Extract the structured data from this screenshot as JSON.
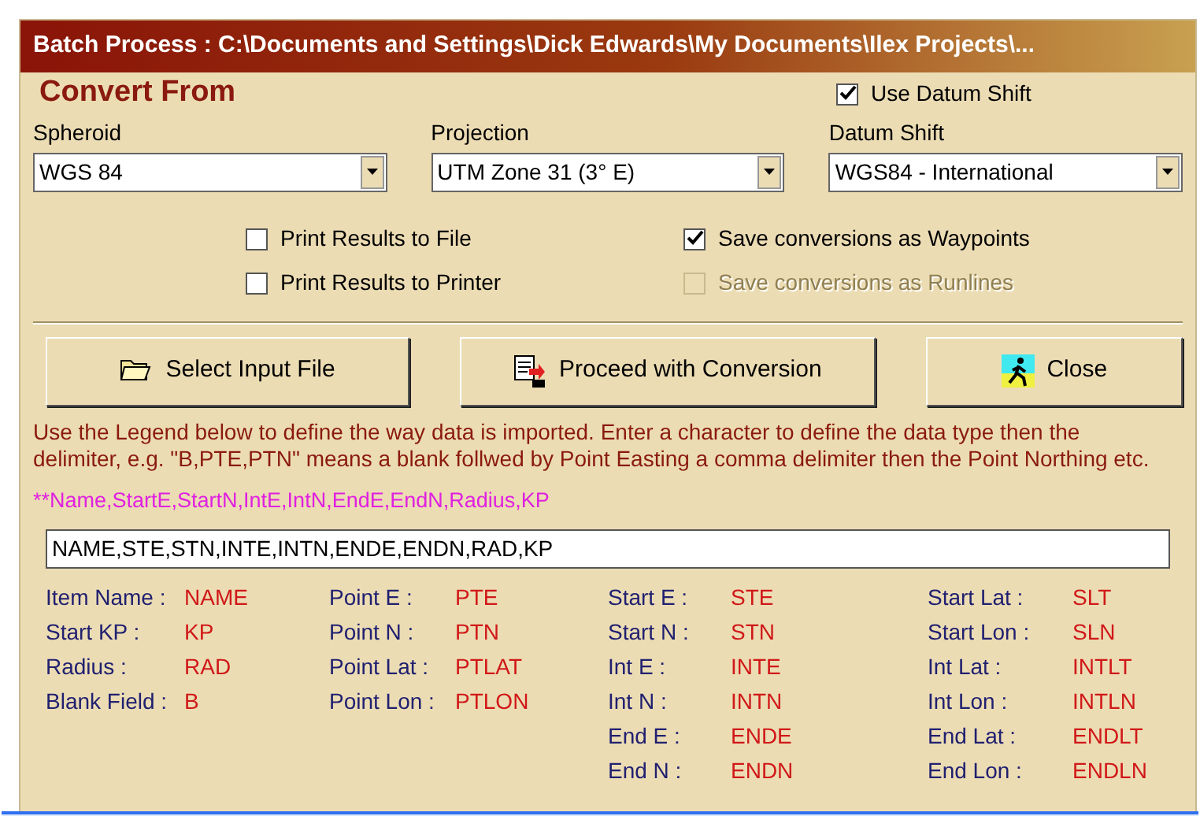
{
  "window": {
    "title": "Batch Process : C:\\Documents and Settings\\Dick Edwards\\My Documents\\Ilex Projects\\..."
  },
  "heading": "Convert From",
  "use_datum_shift": {
    "label": "Use Datum Shift",
    "checked": true
  },
  "dropdowns": [
    {
      "label": "Spheroid",
      "value": "WGS 84"
    },
    {
      "label": "Projection",
      "value": "UTM Zone 31 (3° E)"
    },
    {
      "label": "Datum Shift",
      "value": "WGS84 - International"
    }
  ],
  "options": [
    {
      "label": "Print Results to File",
      "checked": false,
      "disabled": false
    },
    {
      "label": "Print Results to Printer",
      "checked": false,
      "disabled": false
    },
    {
      "label": "Save conversions as Waypoints",
      "checked": true,
      "disabled": false
    },
    {
      "label": "Save conversions as Runlines",
      "checked": false,
      "disabled": true
    }
  ],
  "buttons": [
    {
      "label": "Select Input File"
    },
    {
      "label": "Proceed with Conversion"
    },
    {
      "label": "Close"
    }
  ],
  "instructions": "Use the Legend below to define the way data is imported. Enter a character to define the data type then the delimiter, e.g. \"B,PTE,PTN\" means a blank follwed by Point Easting a comma delimiter then the Point Northing etc.",
  "format_hint": "**Name,StartE,StartN,IntE,IntN,EndE,EndN,Radius,KP",
  "format_field": {
    "value": "NAME,STE,STN,INTE,INTN,ENDE,ENDN,RAD,KP"
  },
  "legend": [
    [
      {
        "label": "Item Name :",
        "code": "NAME"
      },
      {
        "label": "Start KP :",
        "code": "KP"
      },
      {
        "label": "Radius :",
        "code": "RAD"
      },
      {
        "label": "Blank Field :",
        "code": "B"
      }
    ],
    [
      {
        "label": "Point E :",
        "code": "PTE"
      },
      {
        "label": "Point N :",
        "code": "PTN"
      },
      {
        "label": "Point Lat :",
        "code": "PTLAT"
      },
      {
        "label": "Point Lon :",
        "code": "PTLON"
      }
    ],
    [
      {
        "label": "Start E :",
        "code": "STE"
      },
      {
        "label": "Start N :",
        "code": "STN"
      },
      {
        "label": "Int E :",
        "code": "INTE"
      },
      {
        "label": "Int N :",
        "code": "INTN"
      },
      {
        "label": "End E :",
        "code": "ENDE"
      },
      {
        "label": "End N :",
        "code": "ENDN"
      }
    ],
    [
      {
        "label": "Start Lat :",
        "code": "SLT"
      },
      {
        "label": "Start Lon :",
        "code": "SLN"
      },
      {
        "label": "Int Lat :",
        "code": "INTLT"
      },
      {
        "label": "Int Lon :",
        "code": "INTLN"
      },
      {
        "label": "End Lat :",
        "code": "ENDLT"
      },
      {
        "label": "End Lon :",
        "code": "ENDLN"
      }
    ]
  ]
}
